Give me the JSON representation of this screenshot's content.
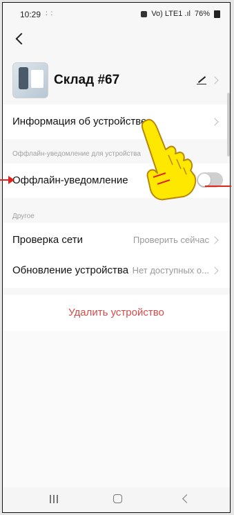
{
  "status_bar": {
    "time": "10:29",
    "notifications": ": :",
    "network": "Vo) LTE1 .ıl",
    "battery": "76%"
  },
  "device": {
    "name": "Склад #67"
  },
  "rows": {
    "device_info": {
      "label": "Информация об устройстве"
    }
  },
  "sections": {
    "offline": "Оффлайн-уведомление для устройства",
    "other": "Другое"
  },
  "offline_notification": {
    "label": "Оффлайн-уведомление",
    "enabled": false
  },
  "network_check": {
    "label": "Проверка сети",
    "value": "Проверить сейчас"
  },
  "device_update": {
    "label": "Обновление устройства",
    "value": "Нет доступных о..."
  },
  "delete_button": "Удалить устройство",
  "colors": {
    "danger": "#d84a4a",
    "annotation": "#e0231c",
    "pointer_fill": "#ffe800"
  },
  "icons": [
    "back-icon",
    "edit-icon",
    "chevron-right-icon",
    "recent-apps-icon",
    "home-icon",
    "nav-back-icon",
    "pointer-hand-icon"
  ]
}
